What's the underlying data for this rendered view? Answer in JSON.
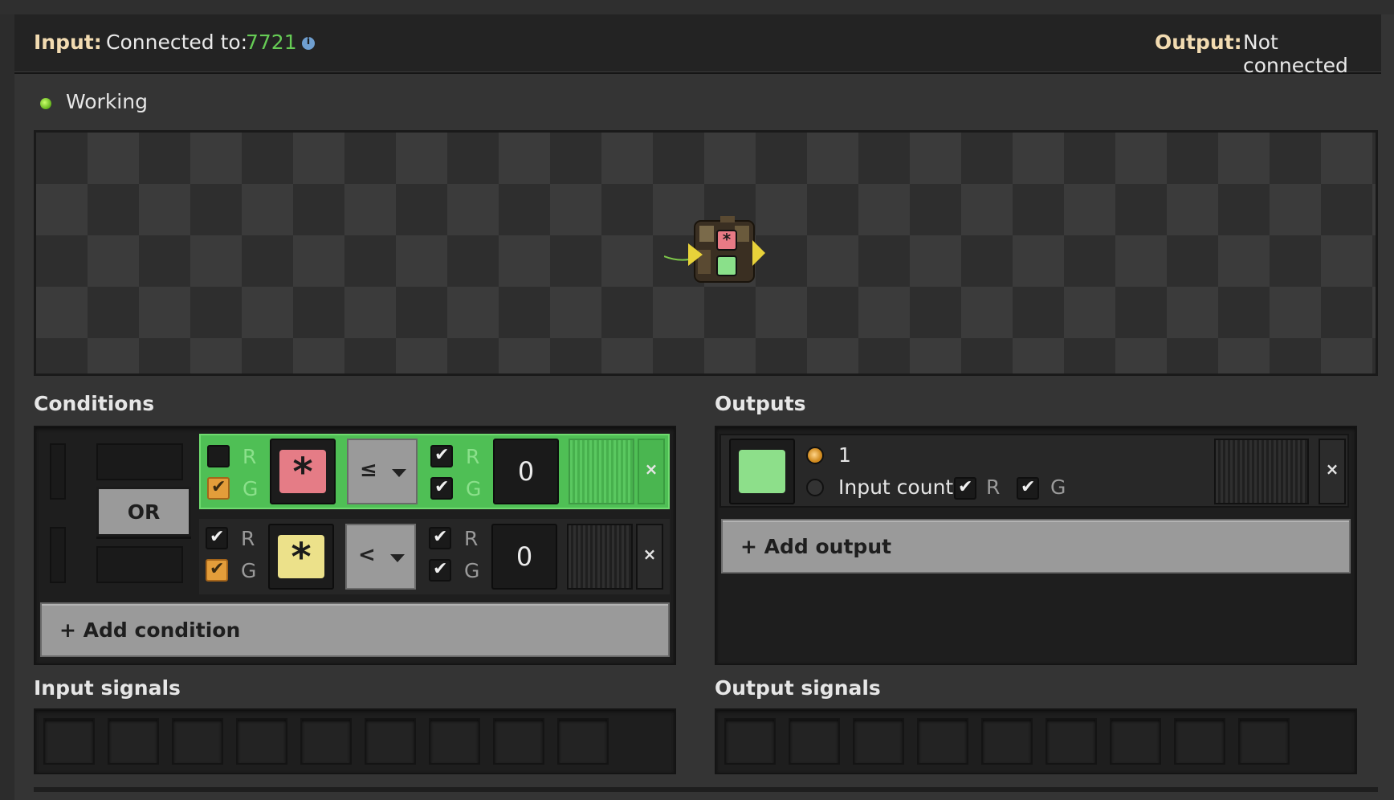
{
  "header": {
    "input_label": "Input:",
    "input_text": "Connected to:",
    "input_network": "7721",
    "output_label": "Output:",
    "output_text": "Not connected"
  },
  "status": {
    "text": "Working",
    "color": "#7fd02a"
  },
  "conditions": {
    "title": "Conditions",
    "join_button": "OR",
    "rows": [
      {
        "left_r": "R",
        "left_g": "G",
        "left_r_checked": false,
        "left_g_checked": true,
        "signal_icon": "asterisk-red",
        "operator": "≤",
        "right_r": "R",
        "right_g": "G",
        "value": "0",
        "active": true
      },
      {
        "left_r": "R",
        "left_g": "G",
        "left_r_checked": true,
        "left_g_checked": true,
        "signal_icon": "asterisk-yellow",
        "operator": "<",
        "right_r": "R",
        "right_g": "G",
        "value": "0",
        "active": false
      }
    ],
    "remove_label": "×",
    "add_label": "+ Add condition"
  },
  "outputs": {
    "title": "Outputs",
    "rows": [
      {
        "signal_icon": "green-square",
        "value": "1",
        "mode": "Input count",
        "r": "R",
        "g": "G",
        "remove_label": "×"
      }
    ],
    "add_label": "+ Add output"
  },
  "input_signals": {
    "title": "Input signals"
  },
  "output_signals": {
    "title": "Output signals"
  },
  "colors": {
    "active_row": "#4fbf55",
    "network_id": "#66cc55",
    "header_label": "#f2dbb1"
  }
}
